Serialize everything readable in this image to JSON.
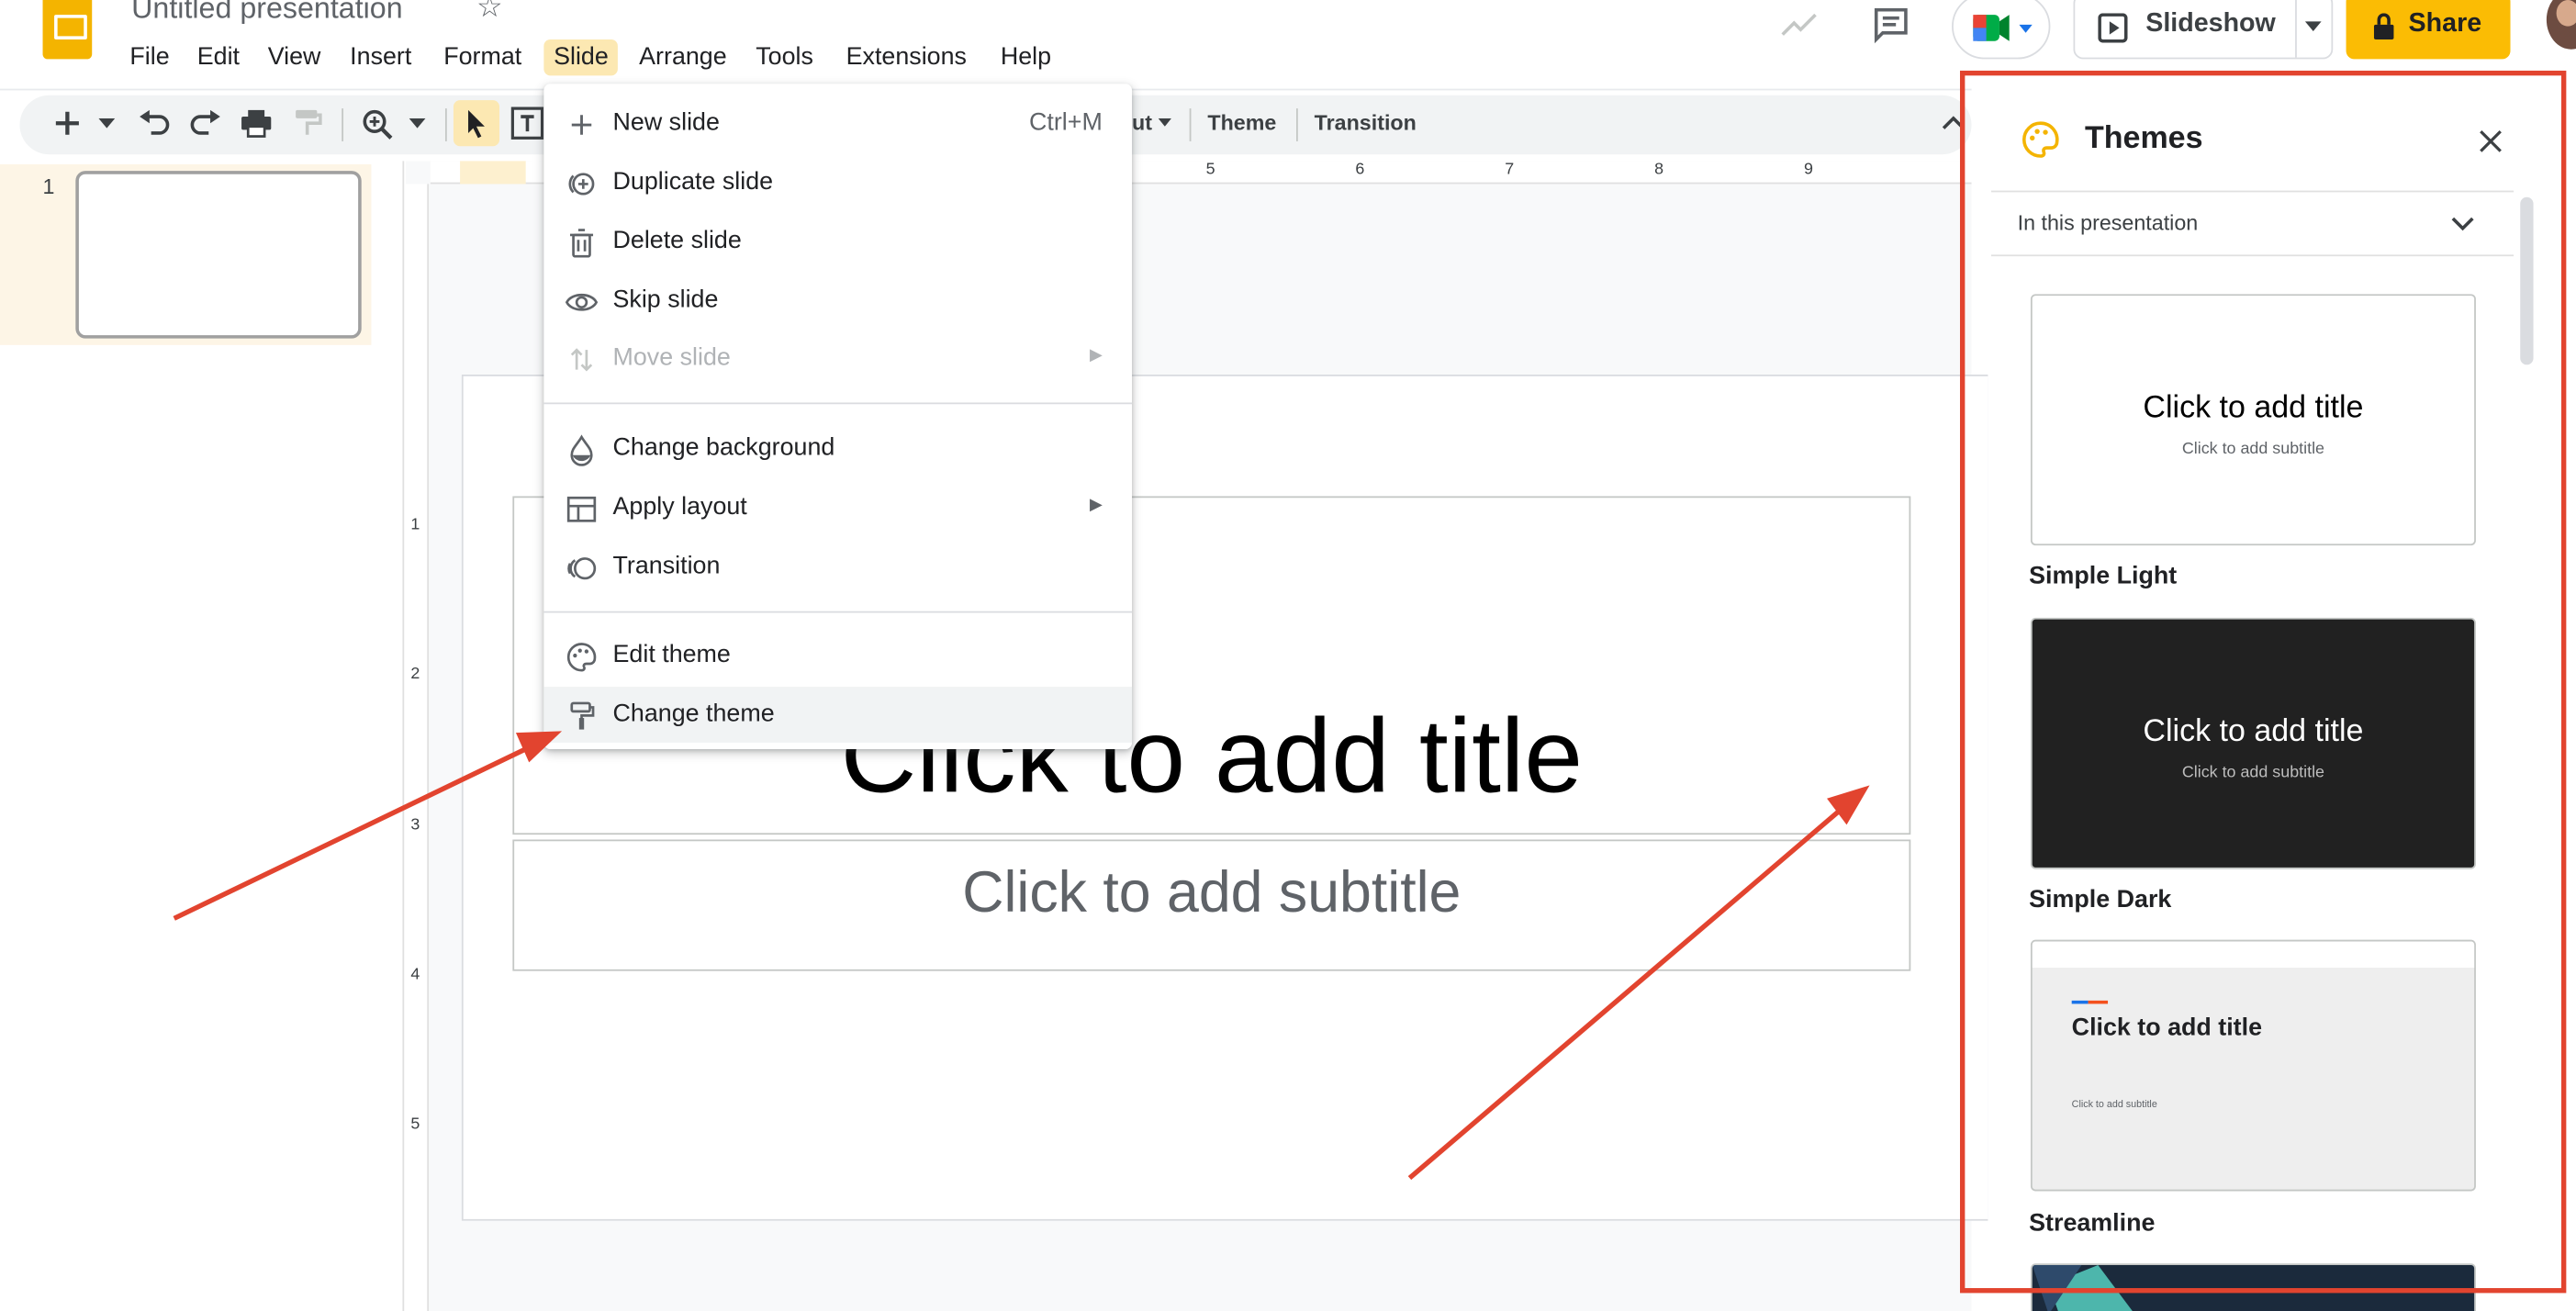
{
  "header": {
    "doc_title": "Untitled presentation",
    "menus": [
      "File",
      "Edit",
      "View",
      "Insert",
      "Format",
      "Slide",
      "Arrange",
      "Tools",
      "Extensions",
      "Help"
    ],
    "active_menu": "Slide",
    "slideshow_label": "Slideshow",
    "share_label": "Share"
  },
  "toolbar": {
    "layout_fragment": "ut",
    "theme_label": "Theme",
    "transition_label": "Transition"
  },
  "filmstrip": {
    "slide_number": "1"
  },
  "rulers": {
    "top": [
      "5",
      "6",
      "7",
      "8",
      "9"
    ],
    "left": [
      "1",
      "2",
      "3",
      "4",
      "5"
    ]
  },
  "slide": {
    "title_placeholder": "Click to add title",
    "subtitle_placeholder": "Click to add subtitle"
  },
  "slide_menu": {
    "items": [
      {
        "label": "New slide",
        "shortcut": "Ctrl+M",
        "icon": "plus-icon"
      },
      {
        "label": "Duplicate slide",
        "icon": "duplicate-icon"
      },
      {
        "label": "Delete slide",
        "icon": "trash-icon"
      },
      {
        "label": "Skip slide",
        "icon": "eye-icon"
      },
      {
        "label": "Move slide",
        "icon": "move-icon",
        "disabled": true,
        "submenu": true
      },
      {
        "label": "Change background",
        "icon": "background-drop-icon"
      },
      {
        "label": "Apply layout",
        "icon": "layout-icon",
        "submenu": true
      },
      {
        "label": "Transition",
        "icon": "transition-icon"
      },
      {
        "label": "Edit theme",
        "icon": "palette-icon"
      },
      {
        "label": "Change theme",
        "icon": "paint-roller-icon",
        "hovered": true
      }
    ]
  },
  "themes_panel": {
    "title": "Themes",
    "section": "In this presentation",
    "themes": [
      {
        "name": "Simple Light",
        "preview_title": "Click to add title",
        "preview_subtitle": "Click to add subtitle"
      },
      {
        "name": "Simple Dark",
        "preview_title": "Click to add title",
        "preview_subtitle": "Click to add subtitle"
      },
      {
        "name": "Streamline",
        "preview_title": "Click to add title",
        "preview_subtitle": "Click to add subtitle"
      }
    ]
  },
  "colors": {
    "accent_yellow": "#fbbc04",
    "annotation_red": "#e2442f",
    "menu_active": "#fce8b2"
  }
}
